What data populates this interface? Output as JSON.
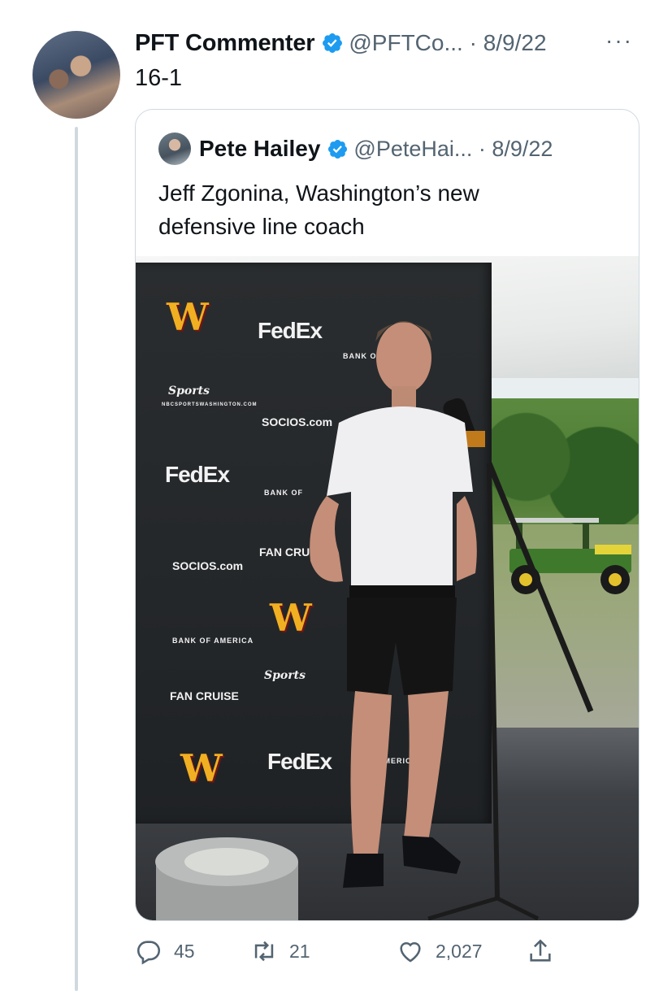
{
  "tweet": {
    "author_name": "PFT Commenter",
    "handle_meta": "@PFTCo... · 8/9/22",
    "more": "···",
    "text": "16-1",
    "verified_icon": "verified-badge-icon",
    "accent_color": "#1d9bf0"
  },
  "quote": {
    "author_name": "Pete Hailey",
    "handle_meta": "@PeteHai... · 8/9/22",
    "text_line1": "Jeff Zgonina, Washington’s new",
    "text_line2": "defensive line coach"
  },
  "photo": {
    "logos": {
      "w": "W",
      "fedex": "FedEx",
      "sports": "Sports",
      "nbcsports_url": "NBCSPORTSWASHINGTON.COM",
      "bank": "BANK OF AMERICA",
      "socios": "SOCIOS.com",
      "fan_cruise": "FAN CRUISE",
      "bank_short": "BANK OF",
      "fan_cruis": "FAN CRUIS",
      "america": "AMERICA",
      "socios_upper": "SOCIOS.COM"
    }
  },
  "actions": {
    "replies": "45",
    "retweets": "21",
    "likes": "2,027"
  }
}
